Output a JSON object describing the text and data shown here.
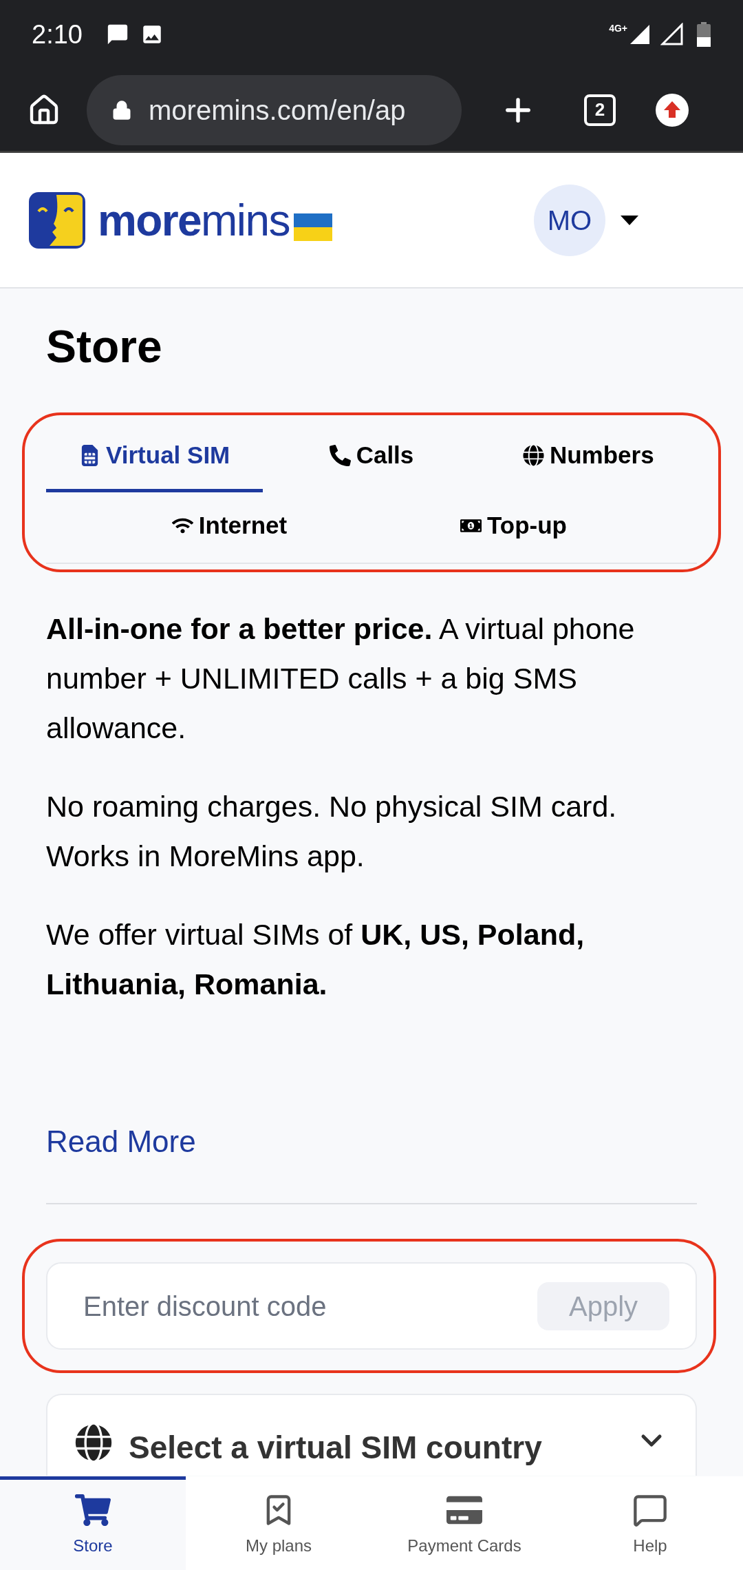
{
  "status_bar": {
    "time": "2:10",
    "network": "4G+"
  },
  "browser": {
    "url": "moremins.com/en/ap",
    "tab_count": "2"
  },
  "header": {
    "logo_bold": "more",
    "logo_light": "mins",
    "avatar": "MO"
  },
  "title": "Store",
  "tabs_highlighted": true,
  "tabs": [
    {
      "label": "Virtual SIM",
      "selected": true
    },
    {
      "label": "Calls",
      "selected": false
    },
    {
      "label": "Numbers",
      "selected": false
    },
    {
      "label": "Internet",
      "selected": false
    },
    {
      "label": "Top-up",
      "selected": false
    }
  ],
  "paragraphs": [
    "**All-in-one for a better price.** A virtual phone number + UNLIMITED calls + a big SMS allowance.",
    "No roaming charges. No physical SIM card. Works in MoreMins app.",
    "We offer virtual SIMs of **UK, US, Poland, Lithuania, Romania.**"
  ],
  "read_more": "Read More",
  "discount": {
    "placeholder": "Enter discount code",
    "button": "Apply",
    "highlighted": true
  },
  "country_select": {
    "label": "Select a virtual SIM country",
    "expanded": false
  },
  "bottom_nav": [
    {
      "label": "Store",
      "selected": true
    },
    {
      "label": "My plans",
      "selected": false
    },
    {
      "label": "Payment Cards",
      "selected": false
    },
    {
      "label": "Help",
      "selected": false
    }
  ]
}
